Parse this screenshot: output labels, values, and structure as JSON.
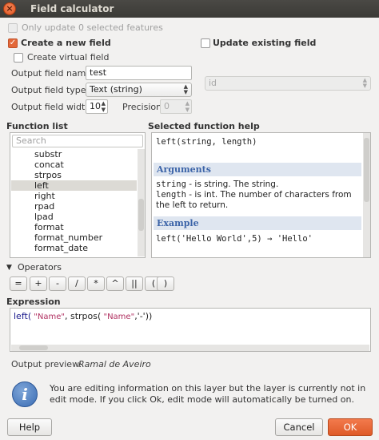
{
  "window": {
    "title": "Field calculator"
  },
  "only_update": {
    "label": "Only update 0 selected features",
    "checked": false,
    "enabled": false
  },
  "create_new_field": {
    "label": "Create a new field",
    "checked": true
  },
  "create_virtual_field": {
    "label": "Create virtual field",
    "checked": false
  },
  "update_existing_field": {
    "label": "Update existing field",
    "checked": false,
    "field_value": "id"
  },
  "output_field_name": {
    "label": "Output field name",
    "value": "test"
  },
  "output_field_type": {
    "label": "Output field type",
    "value": "Text (string)"
  },
  "output_field_width": {
    "label": "Output field width",
    "value": "10"
  },
  "precision": {
    "label": "Precision",
    "value": "0"
  },
  "function_list": {
    "title": "Function list",
    "search_placeholder": "Search",
    "items": [
      "substr",
      "concat",
      "strpos",
      "left",
      "right",
      "rpad",
      "lpad",
      "format",
      "format_number",
      "format_date"
    ],
    "selected": "left"
  },
  "help": {
    "title": "Selected function help",
    "signature": "left(string, length)",
    "arguments_heading": "Arguments",
    "arg1_name": "string",
    "arg1_desc": " - is string. The string.",
    "arg2_name": "length",
    "arg2_desc": " - is int. The number of characters from the left to return.",
    "example_heading": "Example",
    "example": "left('Hello World',5) → 'Hello'"
  },
  "operators": {
    "title": "Operators",
    "buttons": [
      "=",
      "+",
      "-",
      "/",
      "*",
      "^",
      "||",
      "(",
      ")"
    ]
  },
  "expression": {
    "title": "Expression",
    "fn1": "left(",
    "str1": " \"Name\"",
    "mid": ", strpos(",
    "str2": " \"Name\"",
    "tail": ",'-'))"
  },
  "output_preview": {
    "label": "Output preview:",
    "value": "Ramal de Aveiro"
  },
  "info": {
    "message": "You are editing information on this layer but the layer is currently not in edit mode. If you click Ok, edit mode will automatically be turned on."
  },
  "buttons": {
    "help": "Help",
    "cancel": "Cancel",
    "ok": "OK"
  },
  "colors": {
    "accent": "#e3683a",
    "titlebar": "#3b3a36",
    "help_heading": "#3c64a8"
  }
}
